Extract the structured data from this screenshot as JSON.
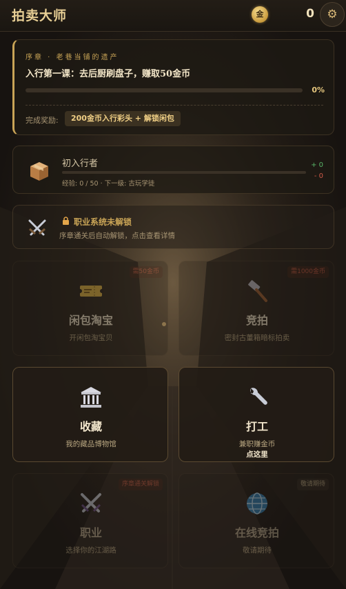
{
  "header": {
    "title": "拍卖大师",
    "coin_symbol": "金",
    "coin_count": "0",
    "settings_icon": "gear-icon"
  },
  "quest": {
    "chapter": "序章 · 老巷当铺的遗产",
    "title": "入行第一课：去后厨刷盘子，赚取50金币",
    "progress": 0,
    "progress_text": "0%",
    "reward_label": "完成奖励:",
    "reward_value": "200金币入行彩头 + 解锁闲包"
  },
  "level": {
    "icon": "box-icon",
    "name": "初入行者",
    "progress": 0,
    "sub": "经验: 0 / 50 · 下一级: 古玩学徒",
    "plus": "+ 0",
    "minus": "- 0"
  },
  "career_lock": {
    "icon": "crossed-swords-icon",
    "title": "职业系统未解锁",
    "sub": "序章通关后自动解锁，点击查看详情"
  },
  "tiles": [
    {
      "id": "taobao",
      "icon": "ticket-icon",
      "title": "闲包淘宝",
      "sub": "开闲包淘宝贝",
      "tag": "需50金币"
    },
    {
      "id": "bid",
      "icon": "hammer-icon",
      "title": "竞拍",
      "sub": "密封古董箱暗标拍卖",
      "tag": "需1000金币"
    },
    {
      "id": "collect",
      "icon": "museum-icon",
      "title": "收藏",
      "sub": "我的藏品博物馆",
      "tag": ""
    },
    {
      "id": "work",
      "icon": "wrench-icon",
      "title": "打工",
      "sub": "兼职赚金币",
      "sub2": "点这里",
      "tag": ""
    },
    {
      "id": "career",
      "icon": "crossed-swords-icon",
      "title": "职业",
      "sub": "选择你的江湖路",
      "tag": "序章通关解锁"
    },
    {
      "id": "online",
      "icon": "globe-icon",
      "title": "在线竞拍",
      "sub": "敬请期待",
      "tag": "敬请期待"
    }
  ],
  "colors": {
    "accent": "#c9a456",
    "background": "#1c1814",
    "tag_red": "#c2553e"
  }
}
